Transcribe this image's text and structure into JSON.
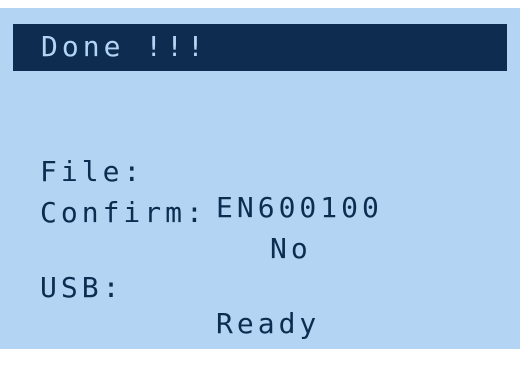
{
  "colors": {
    "screen_background": "#b3d4f2",
    "title_background": "#0d2c4f",
    "text": "#0d2c4f"
  },
  "title": "Done !!!",
  "fields": {
    "file": {
      "label": "File:",
      "value": "EN600100"
    },
    "confirm": {
      "label": "Confirm:",
      "value": "No"
    },
    "usb": {
      "label": "USB:",
      "value": "Ready"
    }
  }
}
